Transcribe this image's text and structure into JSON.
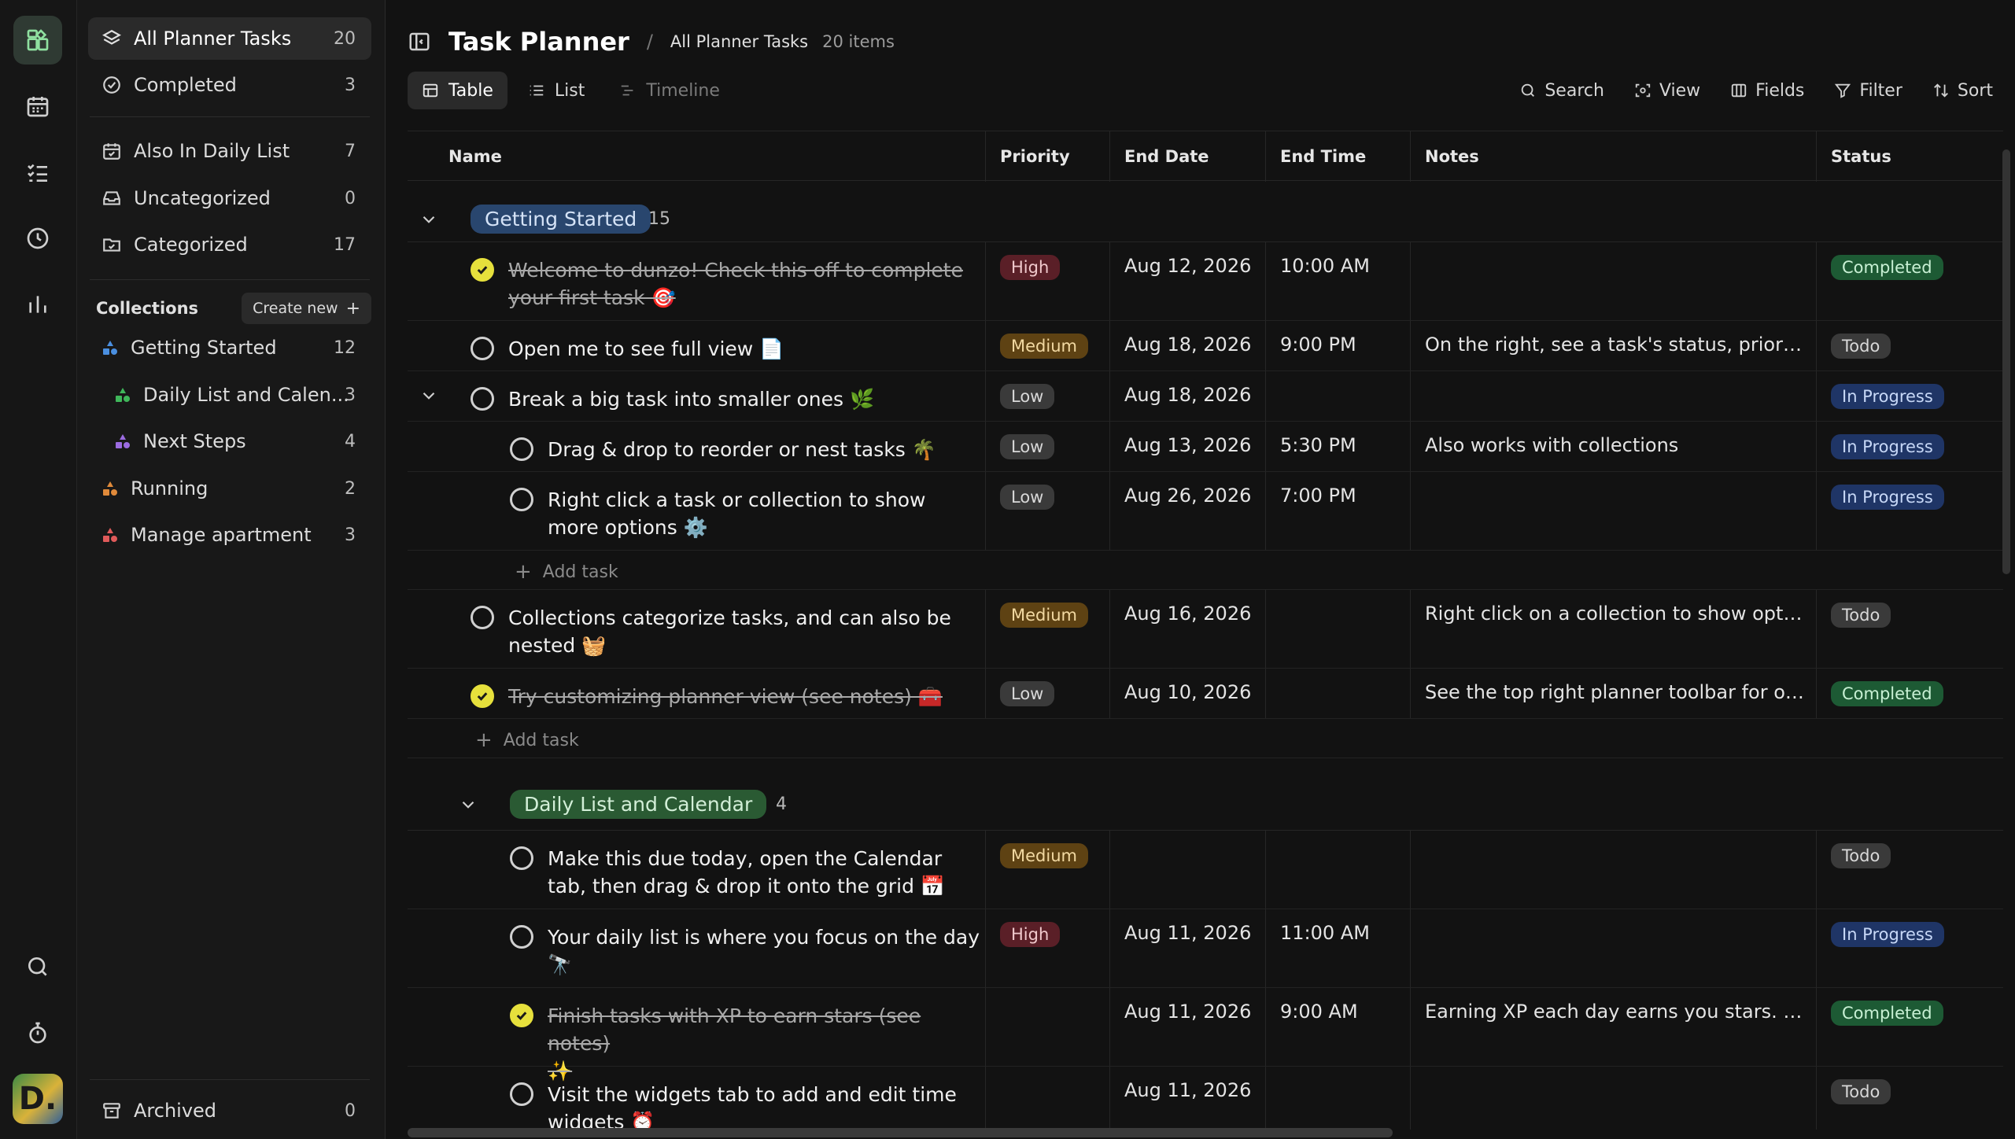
{
  "sidebar": {
    "nav": [
      {
        "label": "All Planner Tasks",
        "count": "20"
      },
      {
        "label": "Completed",
        "count": "3"
      },
      {
        "label": "Also In Daily List",
        "count": "7"
      },
      {
        "label": "Uncategorized",
        "count": "0"
      },
      {
        "label": "Categorized",
        "count": "17"
      }
    ],
    "collections_label": "Collections",
    "create_new_label": "Create new",
    "collections": [
      {
        "label": "Getting Started",
        "count": "12",
        "color": "#4a8fe0"
      },
      {
        "label": "Daily List and Calen...",
        "count": "3",
        "color": "#3fb75a"
      },
      {
        "label": "Next Steps",
        "count": "4",
        "color": "#9b6be0"
      },
      {
        "label": "Running",
        "count": "2",
        "color": "#e08a3a"
      },
      {
        "label": "Manage apartment",
        "count": "3",
        "color": "#e05a5a"
      }
    ],
    "archived": {
      "label": "Archived",
      "count": "0"
    }
  },
  "header": {
    "title": "Task Planner",
    "separator": "/",
    "breadcrumb": "All Planner Tasks",
    "items_count": "20 items"
  },
  "views": [
    {
      "label": "Table"
    },
    {
      "label": "List"
    },
    {
      "label": "Timeline"
    }
  ],
  "tools": [
    {
      "label": "Search",
      "icon": "search-icon"
    },
    {
      "label": "View",
      "icon": "view-icon"
    },
    {
      "label": "Fields",
      "icon": "fields-icon"
    },
    {
      "label": "Filter",
      "icon": "filter-icon"
    },
    {
      "label": "Sort",
      "icon": "sort-icon"
    }
  ],
  "columns": [
    "Name",
    "Priority",
    "End Date",
    "End Time",
    "Notes",
    "Status"
  ],
  "groups": [
    {
      "label": "Getting Started",
      "count": "15"
    },
    {
      "label": "Daily List and Calendar",
      "count": "4"
    }
  ],
  "add_task_label": "Add task",
  "tasks": [
    {
      "line1": "Welcome to dunzo! Check this off to complete",
      "line2": "your first task 🎯",
      "done": true,
      "priority": "High",
      "end_date": "Aug 12, 2026",
      "end_time": "10:00 AM",
      "notes": "",
      "status": "Completed"
    },
    {
      "line1": "Open me to see full view 📄",
      "line2": "",
      "done": false,
      "priority": "Medium",
      "end_date": "Aug 18, 2026",
      "end_time": "9:00 PM",
      "notes": "On the right, see a task's status, priority, ...",
      "status": "Todo"
    },
    {
      "line1": "Break a big task into smaller ones 🌿",
      "line2": "",
      "done": false,
      "priority": "Low",
      "end_date": "Aug 18, 2026",
      "end_time": "",
      "notes": "",
      "status": "In Progress"
    },
    {
      "line1": "Drag & drop to reorder or nest tasks 🌴",
      "line2": "",
      "done": false,
      "priority": "Low",
      "end_date": "Aug 13, 2026",
      "end_time": "5:30 PM",
      "notes": "Also works with collections",
      "status": "In Progress"
    },
    {
      "line1": "Right click a task or collection to show",
      "line2": "more options ⚙️",
      "done": false,
      "priority": "Low",
      "end_date": "Aug 26, 2026",
      "end_time": "7:00 PM",
      "notes": "",
      "status": "In Progress"
    },
    {
      "line1": "Collections categorize tasks, and can also be",
      "line2": "nested 🧺",
      "done": false,
      "priority": "Medium",
      "end_date": "Aug 16, 2026",
      "end_time": "",
      "notes": "Right click on a collection to show option...",
      "status": "Todo"
    },
    {
      "line1": "Try customizing planner view (see notes) 🧰",
      "line2": "",
      "done": true,
      "priority": "Low",
      "end_date": "Aug 10, 2026",
      "end_time": "",
      "notes": "See the top right planner toolbar for opti...",
      "status": "Completed"
    },
    {
      "line1": "Make this due today, open the Calendar",
      "line2": "tab, then drag & drop it onto the grid 📅",
      "done": false,
      "priority": "Medium",
      "end_date": "",
      "end_time": "",
      "notes": "",
      "status": "Todo"
    },
    {
      "line1": "Your daily list is where you focus on the day",
      "line2": "🔭",
      "done": false,
      "priority": "High",
      "end_date": "Aug 11, 2026",
      "end_time": "11:00 AM",
      "notes": "",
      "status": "In Progress"
    },
    {
      "line1": "Finish tasks with XP to earn stars (see notes)",
      "line2": "✨",
      "done": true,
      "priority": "",
      "end_date": "Aug 11, 2026",
      "end_time": "9:00 AM",
      "notes": "Earning XP each day earns you stars. Ear...",
      "status": "Completed"
    },
    {
      "line1": "Visit the widgets tab to add and edit time",
      "line2": "widgets ⏰",
      "done": false,
      "priority": "",
      "end_date": "Aug 11, 2026",
      "end_time": "",
      "notes": "",
      "status": "Todo"
    }
  ]
}
